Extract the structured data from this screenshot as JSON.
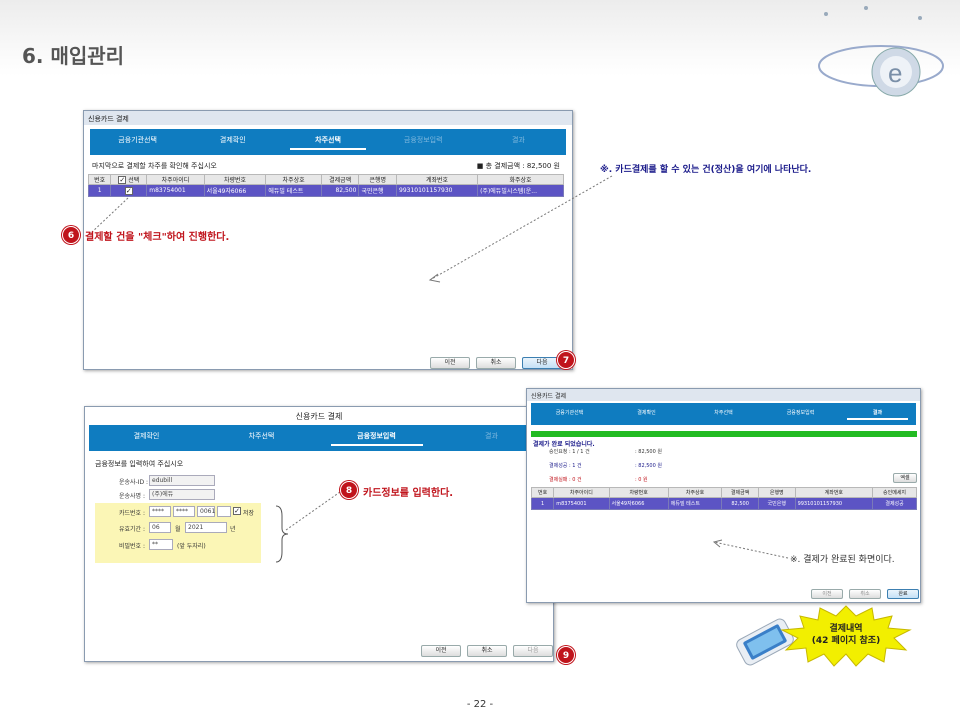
{
  "header": {
    "title": "6. 매입관리"
  },
  "window1": {
    "title": "신용카드 결제",
    "steps": [
      "금융기관선택",
      "결제확인",
      "차주선택",
      "금융정보입력",
      "결과"
    ],
    "message": "마지막으로 결제할 차주를 확인해 주십시오",
    "total": "■ 총 결제금액 : 82,500 원",
    "columns": [
      "번호",
      "선택",
      "차주아이디",
      "차량번호",
      "차주상호",
      "결제금액",
      "은행명",
      "계좌번호",
      "화주상호"
    ],
    "row": [
      "1",
      "✓",
      "m83754001",
      "서울49자6066",
      "에듀빌 테스트",
      "82,500",
      "국민은행",
      "99310101157930",
      "(주)에듀빌시스템(운..."
    ],
    "buttons": {
      "prev": "이전",
      "cancel": "취소",
      "next": "다음"
    }
  },
  "window2": {
    "title": "신용카드 결제",
    "steps": [
      "결제확인",
      "차주선택",
      "금융정보입력",
      "결과"
    ],
    "message": "금융정보를 입력하여 주십시오",
    "fields": {
      "vendor_id_label": "운송사-ID :",
      "vendor_id": "edubill",
      "vendor_name_label": "운송사명 :",
      "vendor_name": "(주)에듀",
      "card_label": "카드번호 :",
      "card1": "****",
      "card2": "****",
      "card3": "****",
      "card4": "0061",
      "save": "저장",
      "expiry_label": "유효기간 :",
      "month": "06",
      "month_unit": "월",
      "year": "2021",
      "year_unit": "년",
      "pw_label": "비밀번호 :",
      "pw": "**",
      "pw_hint": "(앞 두자리)"
    },
    "buttons": {
      "prev": "이전",
      "cancel": "취소",
      "next": "다음"
    }
  },
  "window3": {
    "title": "신용카드 결제",
    "steps": [
      "금융기관선택",
      "결제확인",
      "차주선택",
      "금융정보입력",
      "결과"
    ],
    "done": "결제가 완료 되었습니다.",
    "summary": [
      {
        "label": "승인요청 :  1 / 1 건",
        "value": ": 82,500 원"
      },
      {
        "label": "결제성공 :  1 건",
        "value": ": 82,500 원"
      },
      {
        "label": "결제실패 :  0 건",
        "value": ": 0 원"
      }
    ],
    "excel": "엑셀",
    "columns": [
      "번호",
      "차주아이디",
      "차량번호",
      "차주상호",
      "결제금액",
      "은행명",
      "계좌번호",
      "승인메세지"
    ],
    "row": [
      "1",
      "m83754001",
      "서울49자6066",
      "에듀빌 테스트",
      "82,500",
      "국민은행",
      "99310101157930",
      "결제성공"
    ],
    "buttons": {
      "prev": "이전",
      "cancel": "취소",
      "done": "완료"
    }
  },
  "annotations": {
    "a6": "결제할 건을 \"체크\"하여 진행한다.",
    "a7": "※.  카드결제를 할 수 있는 건(정산)을 여기에 나타난다.",
    "a8": "카드정보를 입력한다.",
    "a9": "※. 결제가 완료된 화면이다.",
    "starburst_line1": "결제내역",
    "starburst_line2": "(42 페이지 참조)"
  },
  "badges": {
    "b6": "6",
    "b7": "7",
    "b8": "8",
    "b9": "9"
  },
  "footer": {
    "page": "- 22 -"
  }
}
